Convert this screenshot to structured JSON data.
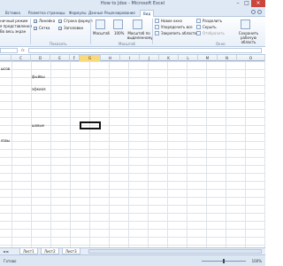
{
  "window": {
    "title": "How to Jdox - Microsoft Excel",
    "minimize": "–",
    "maximize": "□",
    "close": "×"
  },
  "tabs": [
    {
      "label": "Вставка"
    },
    {
      "label": "Разметка страницы"
    },
    {
      "label": "Формулы"
    },
    {
      "label": "Данные"
    },
    {
      "label": "Рецензирование"
    },
    {
      "label": "Вид",
      "active": true
    }
  ],
  "ribbon": {
    "left_items": [
      "ничный режим",
      "я представления",
      "Во весь экран"
    ],
    "show_checks": [
      "Линейка",
      "Сетка"
    ],
    "show_checks_right": [
      "Строка формул",
      "Заголовки"
    ],
    "zoom_buttons": [
      "Масштаб",
      "100%",
      "Масштаб по выделенному"
    ],
    "window_left": [
      "Новое окно",
      "Упорядочить все",
      "Закрепить области"
    ],
    "window_right": [
      "Разделить",
      "Скрыть",
      "Отобразить"
    ],
    "save_workspace": "Сохранить рабочую область",
    "groups": [
      "Показать",
      "Масштаб",
      "Окно"
    ]
  },
  "formula_bar": {
    "fx": "fx"
  },
  "columns": [
    "C",
    "D",
    "E",
    "F",
    "G",
    "H",
    "I",
    "J",
    "K",
    "L",
    "M",
    "N",
    "O"
  ],
  "selected_column": "G",
  "cells": [
    {
      "text": "ысов"
    },
    {
      "text": "фыйвы"
    },
    {
      "text": "эфкиоя"
    },
    {
      "text": "шовьм"
    },
    {
      "text": "язвы"
    }
  ],
  "sheetbar": {
    "nav": "◄ ►",
    "sheets": [
      "Лист1",
      "Лист2",
      "Лист3"
    ]
  },
  "status": {
    "ready": "Готово",
    "zoom": "100%"
  },
  "colors": {
    "ribbon_bg": "#e9f0f9",
    "accent": "#2a63b5",
    "selected_header": "#f9d97a"
  }
}
